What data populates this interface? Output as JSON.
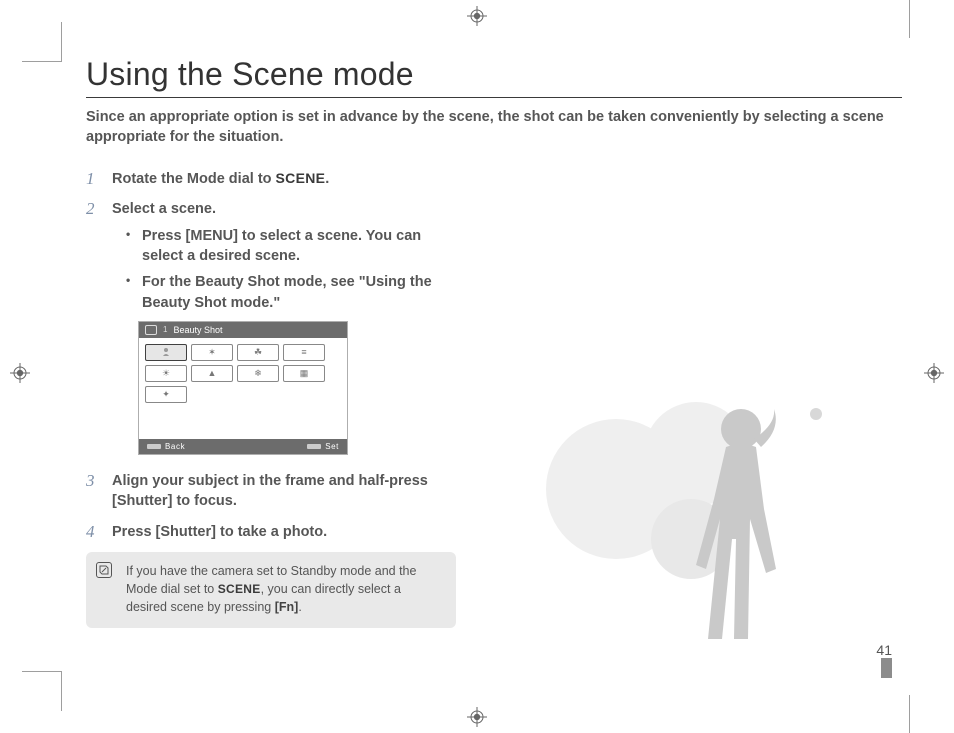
{
  "title": "Using the Scene mode",
  "intro": "Since an appropriate option is set in advance by the scene, the shot can be taken conveniently by selecting a scene appropriate for the situation.",
  "steps": {
    "s1_pre": "Rotate the Mode dial to ",
    "s1_mode": "SCENE",
    "s1_post": ".",
    "s2": "Select a scene.",
    "s2_b1_a": "Press ",
    "s2_b1_menu": "[MENU]",
    "s2_b1_b": " to select a scene. You can select a desired scene.",
    "s2_b2": "For the Beauty Shot mode, see \"Using the Beauty Shot mode.\"",
    "s3_a": "Align your subject in the frame and half-press ",
    "s3_shutter": "[Shutter]",
    "s3_b": " to focus.",
    "s4_a": "Press ",
    "s4_shutter": "[Shutter]",
    "s4_b": " to take a photo."
  },
  "screen": {
    "tab": "1",
    "title": "Beauty Shot",
    "back": "Back",
    "set": "Set"
  },
  "note": {
    "a": "If you have the camera set to Standby mode and the Mode dial set to ",
    "mode": "SCENE",
    "b": ", you can directly select a desired scene by pressing ",
    "fn": "[Fn]",
    "c": "."
  },
  "page_number": "41"
}
